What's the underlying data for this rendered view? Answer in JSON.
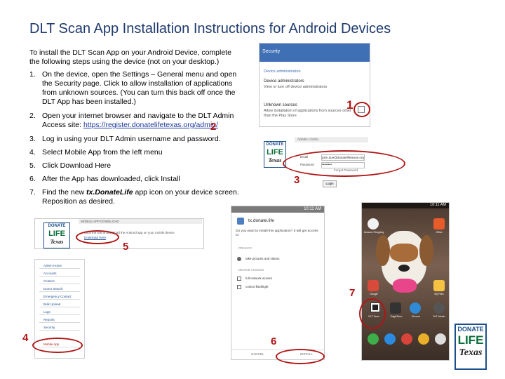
{
  "page": {
    "title": "DLT Scan App Installation Instructions for Android Devices",
    "intro": "To install the DLT Scan App on your Android Device, complete the following steps using the device (not on your desktop.)",
    "steps": [
      {
        "num": "1.",
        "text": "On the device, open the Settings – General menu and open the Security page. Click to allow installation of applications from unknown sources. (You can turn this back off once the DLT App has been installed.)"
      },
      {
        "num": "2.",
        "text_before": "Open your internet browser and navigate to the DLT Admin Access site: ",
        "link": "https://register.donatelifetexas.org/admin/"
      },
      {
        "num": "3.",
        "text": "Log in using your DLT Admin username and password."
      },
      {
        "num": "4.",
        "text": "Select Mobile App from the left menu"
      },
      {
        "num": "5.",
        "text": "Click Download Here"
      },
      {
        "num": "6.",
        "text": "After the App has downloaded, click Install"
      },
      {
        "num": "7.",
        "text_before": "Find the new ",
        "app_name": "tx.DonateLife",
        "text_after": " app icon on your device screen. Reposition as desired."
      }
    ]
  },
  "callouts": [
    "1",
    "2",
    "3",
    "4",
    "5",
    "6",
    "7"
  ],
  "logo": {
    "line1": "DONATE",
    "line2": "LIFE",
    "line3": "Texas"
  },
  "screens": {
    "security": {
      "header": "Security",
      "section": "Device administration",
      "admins_title": "Device administrators",
      "admins_sub": "View or turn off device administrators",
      "unknown_title": "Unknown sources",
      "unknown_sub": "Allow installation of applications from sources other than the Play Store"
    },
    "login": {
      "header": "ADMIN LOGIN",
      "email_label": "Email",
      "email_value": "john.doe@donatelifetexas.org",
      "password_label": "Password",
      "password_value": "••••••••",
      "forgot": "Forgot Password",
      "login_btn": "Login"
    },
    "download": {
      "header": "MOBILE APP DOWNLOAD",
      "text": "Click the link to download the Android app on your mobile device",
      "link": "Download Here",
      "menu": [
        "Admin Home",
        "Accounts",
        "Centers",
        "Donor Search",
        "Emergency Contact",
        "Bulk Upload",
        "Logs",
        "Reports",
        "Security",
        "Mobile App"
      ]
    },
    "install": {
      "status_time": "10:11 AM",
      "app": "tx.donate.life",
      "question": "Do you want to install this application? It will get access to:",
      "privacy": "PRIVACY",
      "perm1": "take pictures and videos",
      "device": "DEVICE ACCESS",
      "perm2": "full network access",
      "perm3": "control flashlight",
      "cancel": "CANCEL",
      "install": "INSTALL"
    },
    "home": {
      "status_time": "10:11 AM",
      "apps": [
        "Amazon Shopping",
        "Google",
        "Office",
        "DLT Scan",
        "EagleTerm",
        "Chrome",
        "DLT Admin",
        "Gmail",
        "My Files"
      ]
    }
  }
}
